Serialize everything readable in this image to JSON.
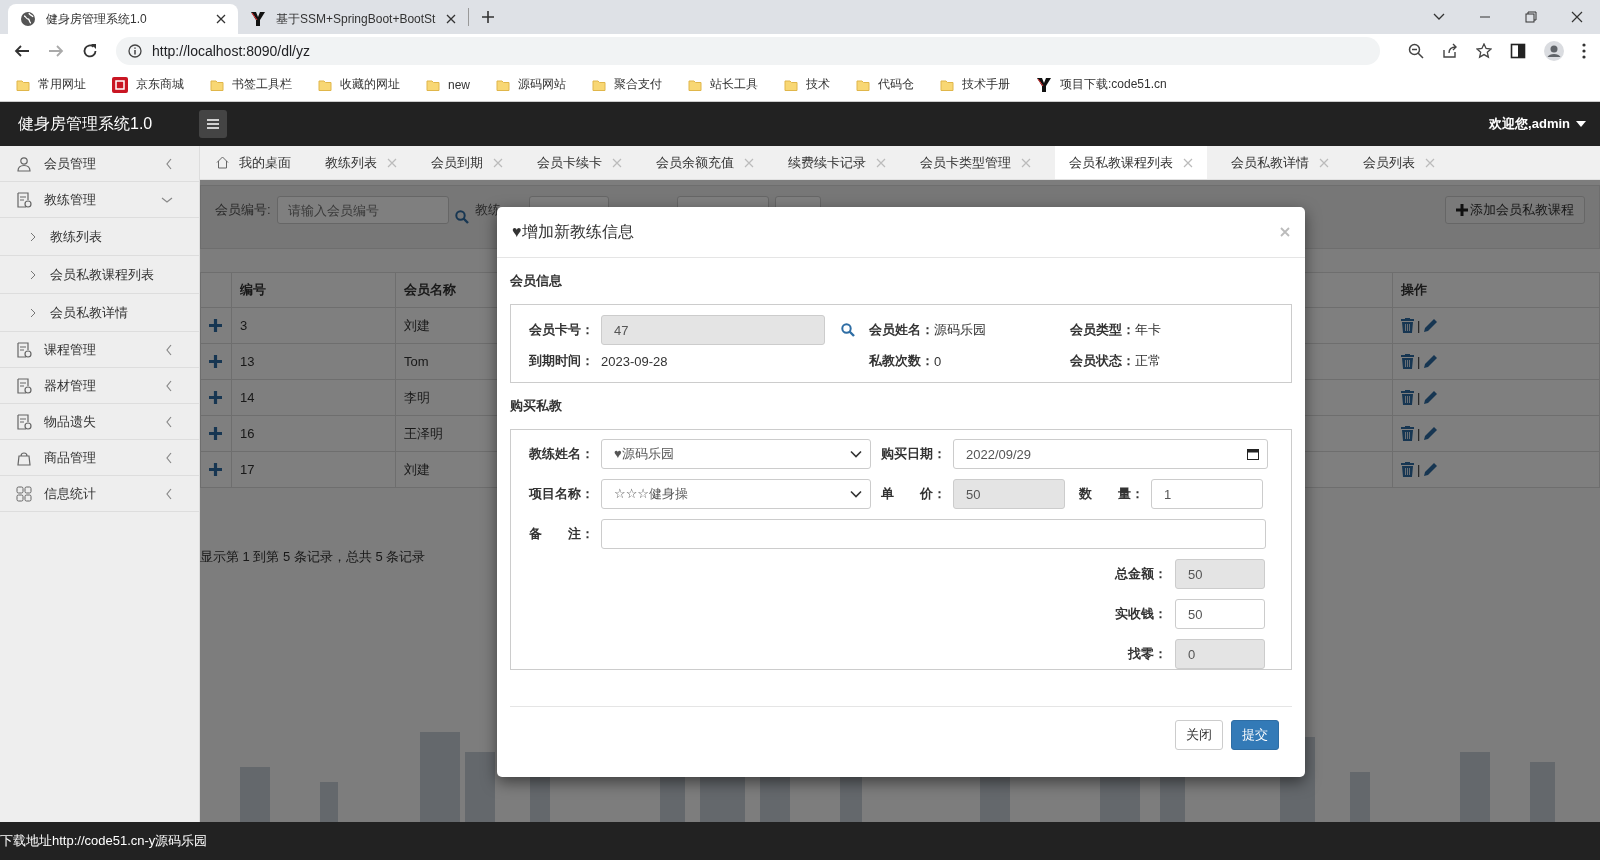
{
  "browser": {
    "tabs": [
      {
        "title": "健身房管理系统1.0",
        "kind": "globe",
        "selected": true
      },
      {
        "title": "基于SSM+SpringBoot+BootSt",
        "kind": "site",
        "selected": false
      }
    ],
    "url": "http://localhost:8090/dl/yz",
    "bookmarks": [
      {
        "label": "常用网址",
        "kind": "folder"
      },
      {
        "label": "京东商城",
        "kind": "jd"
      },
      {
        "label": "书签工具栏",
        "kind": "folder"
      },
      {
        "label": "收藏的网址",
        "kind": "folder"
      },
      {
        "label": "new",
        "kind": "folder"
      },
      {
        "label": "源码网站",
        "kind": "folder"
      },
      {
        "label": "聚合支付",
        "kind": "folder"
      },
      {
        "label": "站长工具",
        "kind": "folder"
      },
      {
        "label": "技术",
        "kind": "folder"
      },
      {
        "label": "代码仓",
        "kind": "folder"
      },
      {
        "label": "技术手册",
        "kind": "folder"
      },
      {
        "label": "项目下载:code51.cn",
        "kind": "site"
      }
    ]
  },
  "header": {
    "title": "健身房管理系统1.0",
    "user": "欢迎您,admin"
  },
  "sidebar": {
    "items": [
      {
        "label": "会员管理",
        "expanded": false
      },
      {
        "label": "教练管理",
        "expanded": true,
        "children": [
          {
            "label": "教练列表"
          },
          {
            "label": "会员私教课程列表"
          },
          {
            "label": "会员私教详情"
          }
        ]
      },
      {
        "label": "课程管理",
        "expanded": false
      },
      {
        "label": "器材管理",
        "expanded": false
      },
      {
        "label": "物品遗失",
        "expanded": false
      },
      {
        "label": "商品管理",
        "expanded": false
      },
      {
        "label": "信息统计",
        "expanded": false
      }
    ]
  },
  "tabs": [
    {
      "label": "我的桌面",
      "kind": "home",
      "selected": false
    },
    {
      "label": "教练列表",
      "kind": "page",
      "selected": false
    },
    {
      "label": "会员到期",
      "kind": "page",
      "selected": false
    },
    {
      "label": "会员卡续卡",
      "kind": "page",
      "selected": false
    },
    {
      "label": "会员余额充值",
      "kind": "page",
      "selected": false
    },
    {
      "label": "续费续卡记录",
      "kind": "page",
      "selected": false
    },
    {
      "label": "会员卡类型管理",
      "kind": "page",
      "selected": false
    },
    {
      "label": "会员私教课程列表",
      "kind": "page",
      "selected": true
    },
    {
      "label": "会员私教详情",
      "kind": "page",
      "selected": false
    },
    {
      "label": "会员列表",
      "kind": "page",
      "selected": false
    }
  ],
  "filter": {
    "member_label": "会员编号:",
    "member_placeholder": "请输入会员编号",
    "coach_label": "教练",
    "add_button": "添加会员私教课程"
  },
  "table": {
    "columns": [
      "编号",
      "会员名称",
      "操作"
    ],
    "rows": [
      {
        "id": "3",
        "name": "刘建",
        "separator": "|"
      },
      {
        "id": "13",
        "name": "Tom",
        "separator": "|"
      },
      {
        "id": "14",
        "name": "李明",
        "separator": "|"
      },
      {
        "id": "16",
        "name": "王泽明",
        "separator": "|"
      },
      {
        "id": "17",
        "name": "刘建",
        "separator": "|"
      }
    ]
  },
  "pager": "显示第 1 到第 5 条记录，总共 5 条记录",
  "modal": {
    "title": "♥增加新教练信息",
    "member_section": "会员信息",
    "card_label": "会员卡号：",
    "card_value": "47",
    "info": [
      {
        "label": "会员姓名：",
        "value": "源码乐园"
      },
      {
        "label": "会员类型：",
        "value": "年卡"
      },
      {
        "label": "到期时间：",
        "value": "2023-09-28"
      },
      {
        "label": "私教次数：",
        "value": "0"
      },
      {
        "label": "会员状态：",
        "value": "正常"
      }
    ],
    "purchase_section": "购买私教",
    "coach": {
      "label": "教练姓名：",
      "value": "♥源码乐园"
    },
    "date": {
      "label": "购买日期：",
      "value": "2022/09/29"
    },
    "course": {
      "label": "项目名称：",
      "value": "☆☆☆健身操"
    },
    "price": {
      "label": "单　　价：",
      "value": "50",
      "readonly": true
    },
    "qty": {
      "label": "数　　量：",
      "value": "1",
      "readonly": false
    },
    "note": {
      "label": "备　　注："
    },
    "totals": [
      {
        "label": "总金额：",
        "value": "50",
        "readonly": true
      },
      {
        "label": "实收钱：",
        "value": "50",
        "readonly": false
      },
      {
        "label": "找零：",
        "value": "0",
        "readonly": true
      }
    ],
    "buttons": [
      {
        "label": "关闭",
        "kind": "default"
      },
      {
        "label": "提交",
        "kind": "primary"
      }
    ]
  },
  "status_bar": "下载地址http://code51.cn-y源码乐园"
}
